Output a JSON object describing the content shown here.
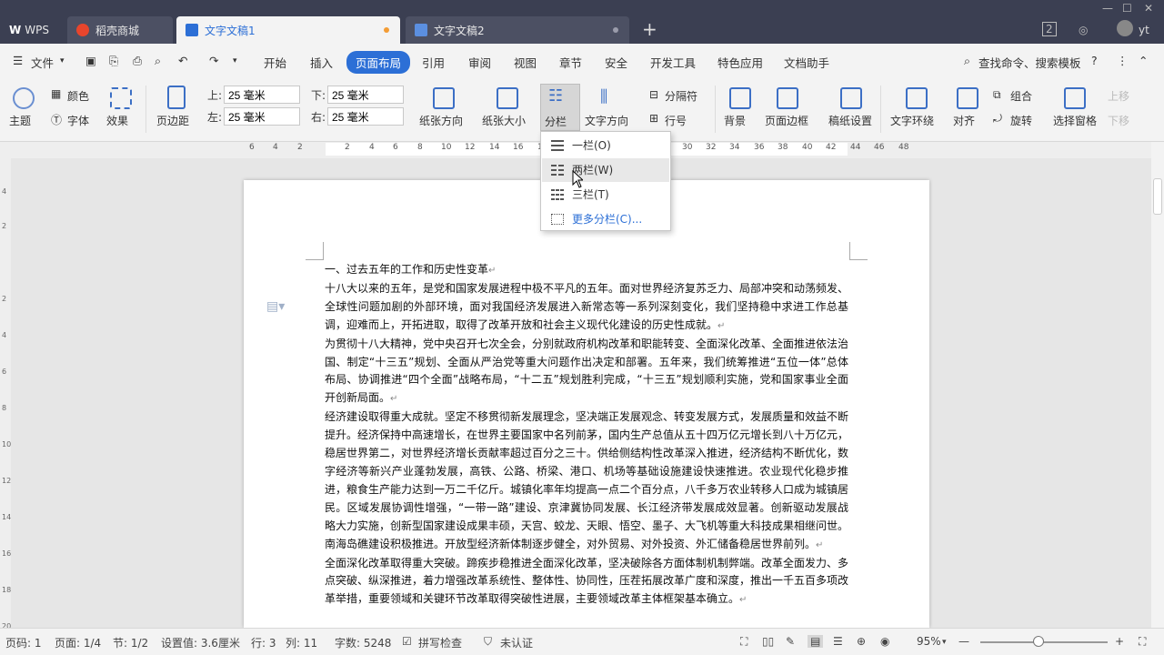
{
  "tabs": {
    "wps": "WPS",
    "daoke": "稻壳商城",
    "doc1": "文字文稿1",
    "doc2": "文字文稿2",
    "badge": "2",
    "user": "yt"
  },
  "menu": {
    "file": "文件",
    "items": [
      "开始",
      "插入",
      "页面布局",
      "引用",
      "审阅",
      "视图",
      "章节",
      "安全",
      "开发工具",
      "特色应用",
      "文档助手"
    ],
    "search": "查找命令、搜索模板"
  },
  "ribbon": {
    "theme": "主题",
    "color": "颜色",
    "font": "字体",
    "effect": "效果",
    "margin": "页边距",
    "top_label": "上:",
    "top_value": "25 毫米",
    "bottom_label": "下:",
    "bottom_value": "25 毫米",
    "left_label": "左:",
    "left_value": "25 毫米",
    "right_label": "右:",
    "right_value": "25 毫米",
    "orientation": "纸张方向",
    "size": "纸张大小",
    "columns": "分栏",
    "text_dir": "文字方向",
    "separator": "分隔符",
    "line_no": "行号",
    "background": "背景",
    "page_border": "页面边框",
    "manuscript": "稿纸设置",
    "wrap": "文字环绕",
    "align": "对齐",
    "group": "组合",
    "rotate": "旋转",
    "selection_pane": "选择窗格",
    "up": "上移",
    "down": "下移"
  },
  "dropdown": [
    "一栏(O)",
    "两栏(W)",
    "三栏(T)",
    "更多分栏(C)..."
  ],
  "ruler": {
    "h": [
      "6",
      "4",
      "2",
      "2",
      "4",
      "6",
      "8",
      "10",
      "12",
      "14",
      "16",
      "18",
      "20",
      "22",
      "24",
      "26",
      "28",
      "30",
      "32",
      "34",
      "36",
      "38",
      "40",
      "42",
      "44",
      "46",
      "48"
    ],
    "v": [
      "4",
      "2",
      "2",
      "4",
      "6",
      "8",
      "10",
      "12",
      "14",
      "16",
      "18",
      "20"
    ]
  },
  "document": {
    "paragraphs": [
      "一、过去五年的工作和历史性变革",
      "十八大以来的五年，是党和国家发展进程中极不平凡的五年。面对世界经济复苏乏力、局部冲突和动荡频发、全球性问题加剧的外部环境，面对我国经济发展进入新常态等一系列深刻变化，我们坚持稳中求进工作总基调，迎难而上，开拓进取，取得了改革开放和社会主义现代化建设的历史性成就。",
      "为贯彻十八大精神，党中央召开七次全会，分别就政府机构改革和职能转变、全面深化改革、全面推进依法治国、制定“十三五”规划、全面从严治党等重大问题作出决定和部署。五年来，我们统筹推进“五位一体”总体布局、协调推进“四个全面”战略布局，“十二五”规划胜利完成，“十三五”规划顺利实施，党和国家事业全面开创新局面。",
      "经济建设取得重大成就。坚定不移贯彻新发展理念，坚决端正发展观念、转变发展方式，发展质量和效益不断提升。经济保持中高速增长，在世界主要国家中名列前茅，国内生产总值从五十四万亿元增长到八十万亿元，稳居世界第二，对世界经济增长贡献率超过百分之三十。供给侧结构性改革深入推进，经济结构不断优化，数字经济等新兴产业蓬勃发展，高铁、公路、桥梁、港口、机场等基础设施建设快速推进。农业现代化稳步推进，粮食生产能力达到一万二千亿斤。城镇化率年均提高一点二个百分点，八千多万农业转移人口成为城镇居民。区域发展协调性增强，“一带一路”建设、京津冀协同发展、长江经济带发展成效显著。创新驱动发展战略大力实施，创新型国家建设成果丰硕，天宫、蛟龙、天眼、悟空、墨子、大飞机等重大科技成果相继问世。南海岛礁建设积极推进。开放型经济新体制逐步健全，对外贸易、对外投资、外汇储备稳居世界前列。",
      "全面深化改革取得重大突破。蹄疾步稳推进全面深化改革，坚决破除各方面体制机制弊端。改革全面发力、多点突破、纵深推进，着力增强改革系统性、整体性、协同性，压茬拓展改革广度和深度，推出一千五百多项改革举措，重要领域和关键环节改革取得突破性进展，主要领域改革主体框架基本确立。"
    ]
  },
  "status": {
    "page_code": "页码: 1",
    "page": "页面: 1/4",
    "section": "节: 1/2",
    "setting": "设置值: 3.6厘米",
    "row": "行: 3",
    "col": "列: 11",
    "words": "字数: 5248",
    "spell": "拼写检查",
    "cert": "未认证",
    "zoom": "95%"
  },
  "colors": {
    "accent": "#2c6fd6",
    "titlebar": "#3b3f52",
    "doc1_dot": "#f39c34"
  }
}
